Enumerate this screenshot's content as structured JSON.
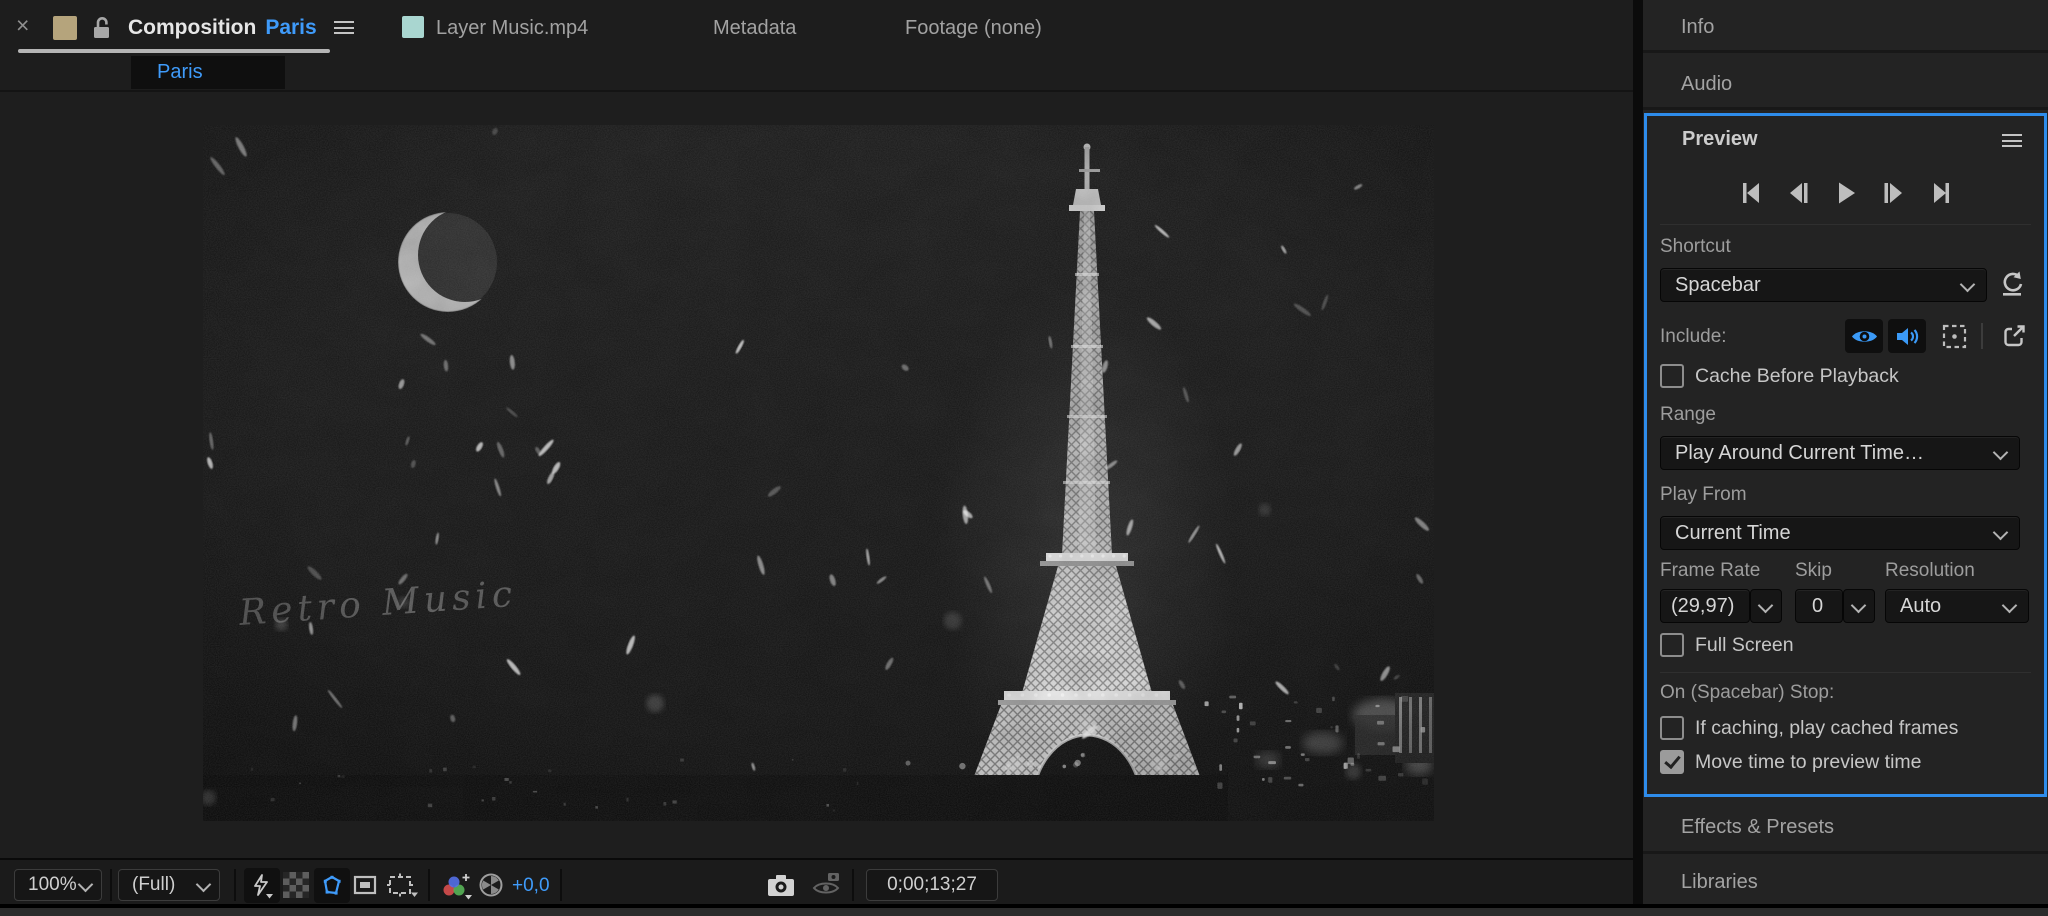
{
  "tab_bar": {
    "close_icon": "×",
    "composition_label": "Composition",
    "composition_name": "Paris",
    "composition_swatch": "#b5a47c",
    "layer_label": "Layer Music.mp4",
    "layer_swatch": "#a9d6d0",
    "metadata_label": "Metadata",
    "footage_label": "Footage (none)"
  },
  "viewer": {
    "active_tab": "Paris",
    "watermark": "Retro Music"
  },
  "toolbar": {
    "zoom_value": "100%",
    "resolution_value": "(Full)",
    "exposure_value": "+0,0",
    "timecode": "0;00;13;27"
  },
  "panels": {
    "info": "Info",
    "audio": "Audio",
    "preview": "Preview",
    "effects_presets": "Effects & Presets",
    "libraries": "Libraries"
  },
  "preview_panel": {
    "transport": [
      "go-to-start",
      "step-back",
      "play",
      "step-forward",
      "go-to-end"
    ],
    "shortcut_label": "Shortcut",
    "shortcut_value": "Spacebar",
    "include_label": "Include:",
    "include_video_on": true,
    "include_audio_on": true,
    "include_overlays_on": false,
    "cache_before_playback": {
      "label": "Cache Before Playback",
      "checked": false
    },
    "range_label": "Range",
    "range_value": "Play Around Current Time…",
    "play_from_label": "Play From",
    "play_from_value": "Current Time",
    "frame_rate_label": "Frame Rate",
    "frame_rate_value": "(29,97)",
    "skip_label": "Skip",
    "skip_value": "0",
    "resolution_label": "Resolution",
    "resolution_value": "Auto",
    "full_screen": {
      "label": "Full Screen",
      "checked": false
    },
    "on_stop_label": "On (Spacebar) Stop:",
    "if_caching": {
      "label": "If caching, play cached frames",
      "checked": false
    },
    "move_time": {
      "label": "Move time to preview time",
      "checked": true
    }
  },
  "colors": {
    "accent_blue": "#3f9bfa",
    "panel_border_blue": "#2e8ceb"
  }
}
